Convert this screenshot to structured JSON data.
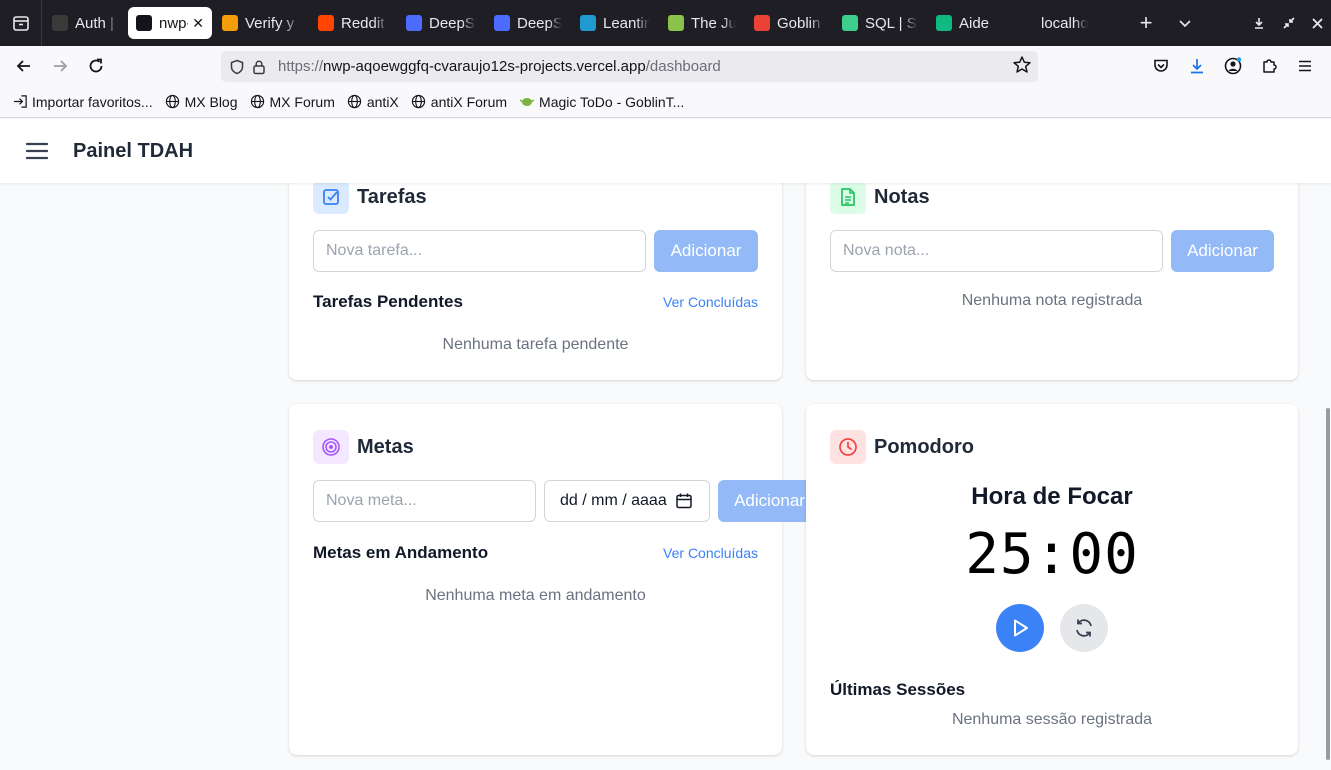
{
  "browser": {
    "tabs": [
      {
        "title": "Auth |",
        "icon_color": "#3a3a3a",
        "active": false
      },
      {
        "title": "nwp-",
        "icon_color": "#15141a",
        "active": true
      },
      {
        "title": "Verify y",
        "icon_color": "#f59e0b",
        "active": false
      },
      {
        "title": "Reddit",
        "icon_color": "#ff4500",
        "active": false
      },
      {
        "title": "DeepSe",
        "icon_color": "#4d6bfe",
        "active": false
      },
      {
        "title": "DeepSe",
        "icon_color": "#4d6bfe",
        "active": false
      },
      {
        "title": "Leantin",
        "icon_color": "#1f9bd1",
        "active": false
      },
      {
        "title": "The Juc",
        "icon_color": "#8bc34a",
        "active": false
      },
      {
        "title": "Goblin",
        "icon_color": "#ea4335",
        "active": false
      },
      {
        "title": "SQL | S",
        "icon_color": "#3ecf8e",
        "active": false
      },
      {
        "title": "Aide",
        "icon_color": "#10b981",
        "active": false
      },
      {
        "title": "localho",
        "icon_color": "#1f1e25",
        "active": false
      }
    ],
    "url": {
      "scheme": "https://",
      "host": "nwp-aqoewggfq-cvaraujo12s-projects.vercel.app",
      "path": "/dashboard"
    },
    "bookmarks": [
      {
        "label": "Importar favoritos...",
        "icon": "import-icon"
      },
      {
        "label": "MX Blog",
        "icon": "globe-icon"
      },
      {
        "label": "MX Forum",
        "icon": "globe-icon"
      },
      {
        "label": "antiX",
        "icon": "globe-icon"
      },
      {
        "label": "antiX Forum",
        "icon": "globe-icon"
      },
      {
        "label": "Magic ToDo - GoblinT...",
        "icon": "goblin-icon"
      }
    ]
  },
  "app": {
    "title": "Painel TDAH",
    "tasks": {
      "title": "Tarefas",
      "input_placeholder": "Nova tarefa...",
      "add_label": "Adicionar",
      "pending_title": "Tarefas Pendentes",
      "completed_link": "Ver Concluídas",
      "empty": "Nenhuma tarefa pendente",
      "accent": "#3b82f6"
    },
    "notes": {
      "title": "Notas",
      "input_placeholder": "Nova nota...",
      "add_label": "Adicionar",
      "empty": "Nenhuma nota registrada",
      "accent": "#22c55e"
    },
    "goals": {
      "title": "Metas",
      "input_placeholder": "Nova meta...",
      "date_placeholder": "dd / mm / aaaa",
      "add_label": "Adicionar",
      "progress_title": "Metas em Andamento",
      "completed_link": "Ver Concluídas",
      "empty": "Nenhuma meta em andamento",
      "accent": "#a855f7"
    },
    "pomodoro": {
      "title": "Pomodoro",
      "mode": "Hora de Focar",
      "time": "25:00",
      "sessions_title": "Últimas Sessões",
      "empty": "Nenhuma sessão registrada",
      "accent": "#ef4444",
      "play_color": "#3b82f6"
    }
  }
}
